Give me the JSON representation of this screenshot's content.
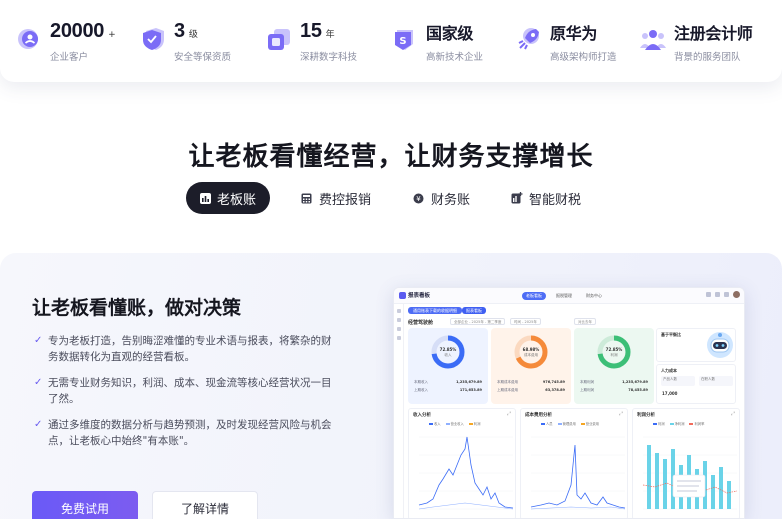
{
  "stats": [
    {
      "value": "20000",
      "unit": "+",
      "sub": "企业客户",
      "icon": "users-badge-icon",
      "color": "#7b6cf6"
    },
    {
      "value": "3",
      "unit": "级",
      "sub": "安全等保资质",
      "icon": "shield-icon",
      "color": "#7b6cf6"
    },
    {
      "value": "15",
      "unit": "年",
      "sub": "深耕数字科技",
      "icon": "layers-icon",
      "color": "#7b6cf6"
    },
    {
      "value": "国家级",
      "unit": "",
      "sub": "高新技术企业",
      "icon": "medal-icon",
      "color": "#7b6cf6"
    },
    {
      "value": "原华为",
      "unit": "",
      "sub": "高级架构师打造",
      "icon": "rocket-icon",
      "color": "#7b6cf6"
    },
    {
      "value": "注册会计师",
      "unit": "",
      "sub": "背景的服务团队",
      "icon": "team-icon",
      "color": "#7b6cf6"
    }
  ],
  "hero": {
    "title": "让老板看懂经营，让财务支撑增长",
    "tabs": [
      {
        "label": "老板账",
        "icon": "bar-chart-icon",
        "active": true
      },
      {
        "label": "费控报销",
        "icon": "calculator-icon",
        "active": false
      },
      {
        "label": "财务账",
        "icon": "coin-icon",
        "active": false
      },
      {
        "label": "智能财税",
        "icon": "chart-plus-icon",
        "active": false
      }
    ]
  },
  "panel": {
    "title": "让老板看懂账，做对决策",
    "features": [
      "专为老板打造，告别晦涩难懂的专业术语与报表，将繁杂的财务数据转化为直观的经营看板。",
      "无需专业财务知识，利润、成本、现金流等核心经营状况一目了然。",
      "通过多维度的数据分析与趋势预测，及时发现经营风险与机会点，让老板心中始终\"有本账\"。"
    ],
    "primary_button": "免费试用",
    "secondary_button": "了解详情"
  },
  "dashboard": {
    "logo": "报表看板",
    "top_tabs": [
      "老板看板",
      "报税管理",
      "财务中心"
    ],
    "sub_tab": "通用账表下载的收据明细",
    "sub_tab2": "报表看板",
    "section": "经营驾驶舱",
    "filters": [
      "全部企业 - 2025年 - 第二季度",
      "时间 - 2025年",
      "对比去年"
    ],
    "kpis": [
      {
        "pct": "72.85%",
        "label": "收入",
        "rows": [
          [
            "本期收入",
            "1,235,679.89"
          ],
          [
            "上期收入",
            "171,653.89"
          ]
        ],
        "color": "#3b6cf6",
        "bg": "#eef3ff"
      },
      {
        "pct": "68.98%",
        "label": "成本费用",
        "rows": [
          [
            "本期成本费用",
            "976,745.89"
          ],
          [
            "上期成本费用",
            "63,378.89"
          ]
        ],
        "color": "#f58a3a",
        "bg": "#fff3ea"
      },
      {
        "pct": "72.85%",
        "label": "利润",
        "rows": [
          [
            "本期利润",
            "1,235,679.89"
          ],
          [
            "上期利润",
            "78,455.89"
          ]
        ],
        "color": "#3cbf77",
        "bg": "#ecf8f1"
      }
    ],
    "side": {
      "title": "基于平衡比",
      "title2": "人力成本",
      "box1": "产品人数",
      "box2": "在职人数",
      "value": "17,000"
    },
    "charts": [
      {
        "title": "收入分析",
        "legend": [
          "收入",
          "营业收入",
          "利润"
        ]
      },
      {
        "title": "成本费用分析",
        "legend": [
          "人员",
          "管理费用",
          "营业费用"
        ]
      },
      {
        "title": "利润分析",
        "legend": [
          "利润",
          "净利润",
          "利润率"
        ]
      }
    ]
  }
}
